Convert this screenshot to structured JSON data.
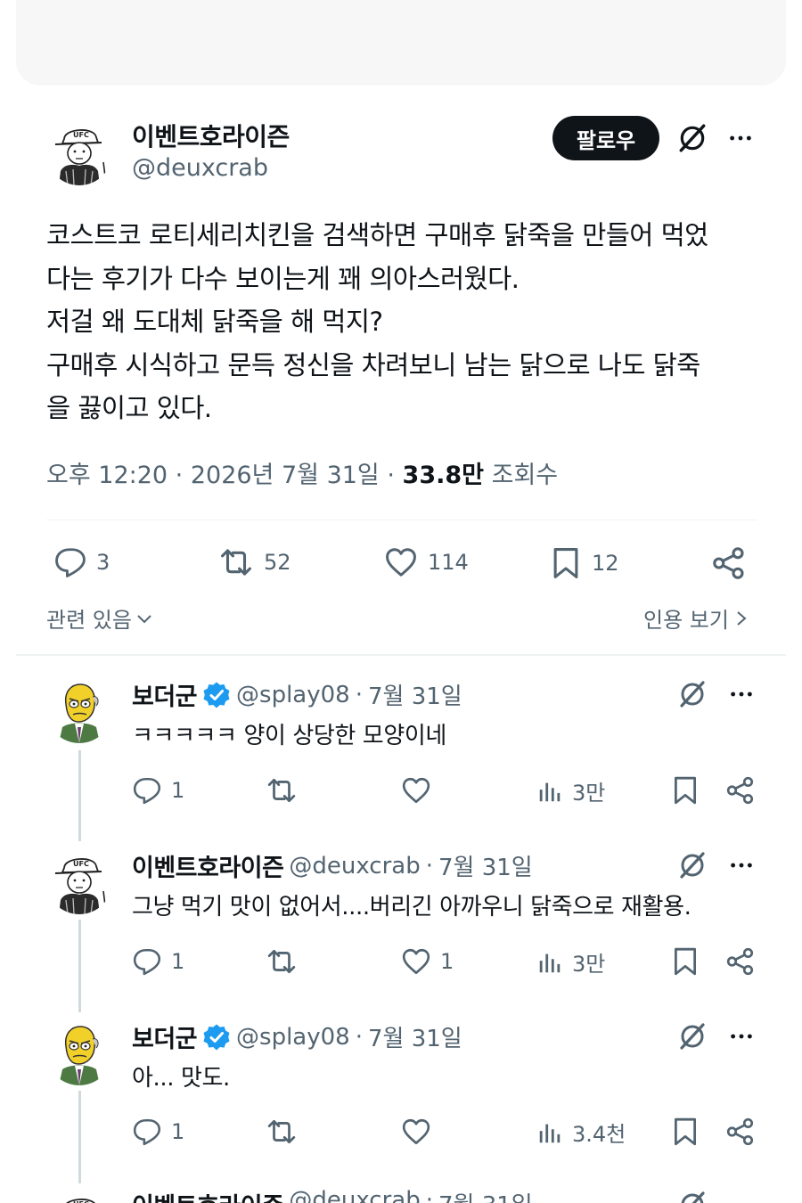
{
  "tweet": {
    "author_name": "이벤트호라이즌",
    "author_handle": "@deuxcrab",
    "follow_label": "팔로우",
    "lines": [
      "코스트코 로티세리치킨을 검색하면 구매후 닭죽을 만들어 먹었",
      "다는 후기가 다수 보이는게 꽤 의아스러웠다.",
      "저걸 왜 도대체 닭죽을 해 먹지?",
      "구매후 시식하고 문득 정신을 차려보니 남는 닭으로 나도 닭죽",
      "을 끓이고 있다."
    ],
    "time": "오후 12:20",
    "date": "2026년 7월 31일",
    "views_count": "33.8만",
    "views_label": "조회수",
    "stats": {
      "replies": "3",
      "reposts": "52",
      "likes": "114",
      "bookmarks": "12"
    },
    "related_label": "관련 있음",
    "quotes_label": "인용 보기"
  },
  "replies": [
    {
      "name": "보더군",
      "handle": "@splay08",
      "date": "7월 31일",
      "verified": true,
      "text": "ㅋㅋㅋㅋㅋ 양이 상당한 모양이네",
      "replies": "1",
      "reposts": "",
      "likes": "",
      "views": "3만"
    },
    {
      "name": "이벤트호라이즌",
      "handle": "@deuxcrab",
      "date": "7월 31일",
      "verified": false,
      "text": "그냥 먹기 맛이 없어서....버리긴 아까우니 닭죽으로 재활용.",
      "replies": "1",
      "reposts": "",
      "likes": "1",
      "views": "3만"
    },
    {
      "name": "보더군",
      "handle": "@splay08",
      "date": "7월 31일",
      "verified": true,
      "text": "아... 맛도.",
      "replies": "1",
      "reposts": "",
      "likes": "",
      "views": "3.4천"
    },
    {
      "name": "이벤트호라이즌",
      "handle": "@deuxcrab",
      "date": "7월 31일",
      "verified": false,
      "text": "",
      "partial": true
    }
  ],
  "colors": {
    "text_primary": "#0f1419",
    "text_secondary": "#536471",
    "verified_blue": "#1d9bf0",
    "follow_bg": "#0f1419",
    "divider": "#eff3f4"
  },
  "icons": [
    "grok-icon",
    "more-icon",
    "reply-icon",
    "repost-icon",
    "like-icon",
    "bookmark-icon",
    "share-icon",
    "views-icon",
    "verified-icon",
    "chevron-down-icon",
    "chevron-right-icon"
  ]
}
